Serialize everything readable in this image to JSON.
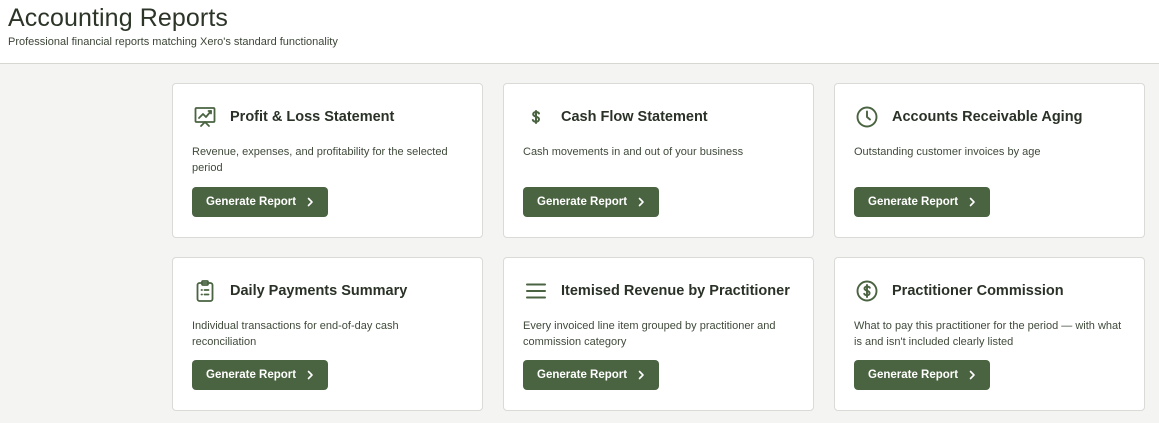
{
  "header": {
    "title": "Accounting Reports",
    "subtitle": "Professional financial reports matching Xero's standard functionality"
  },
  "cards": [
    {
      "title": "Profit & Loss Statement",
      "description": "Revenue, expenses, and profitability for the selected period",
      "button_label": "Generate Report",
      "icon": "presentation-chart-icon"
    },
    {
      "title": "Cash Flow Statement",
      "description": "Cash movements in and out of your business",
      "button_label": "Generate Report",
      "icon": "dollar-sign-icon"
    },
    {
      "title": "Accounts Receivable Aging",
      "description": "Outstanding customer invoices by age",
      "button_label": "Generate Report",
      "icon": "clock-icon"
    },
    {
      "title": "Daily Payments Summary",
      "description": "Individual transactions for end-of-day cash reconciliation",
      "button_label": "Generate Report",
      "icon": "clipboard-list-icon"
    },
    {
      "title": "Itemised Revenue by Practitioner",
      "description": "Every invoiced line item grouped by practitioner and commission category",
      "button_label": "Generate Report",
      "icon": "list-lines-icon"
    },
    {
      "title": "Practitioner Commission",
      "description": "What to pay this practitioner for the period — with what is and isn't included clearly listed",
      "button_label": "Generate Report",
      "icon": "circle-dollar-icon"
    }
  ],
  "colors": {
    "accent": "#4a6340",
    "background": "#f4f4f2",
    "card": "#ffffff"
  }
}
